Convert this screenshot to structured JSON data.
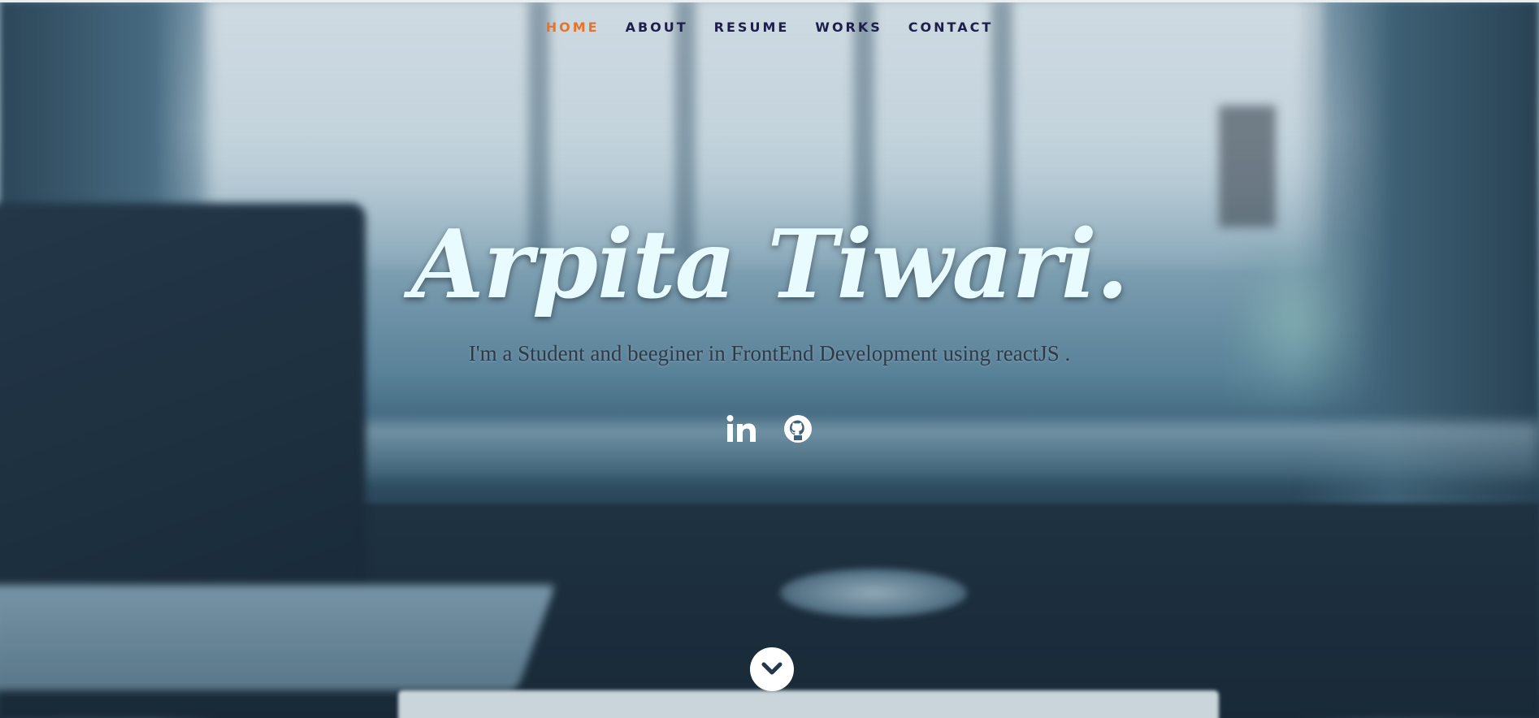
{
  "nav": {
    "items": [
      {
        "label": "HOME",
        "active": true
      },
      {
        "label": "ABOUT"
      },
      {
        "label": "RESUME"
      },
      {
        "label": "WORKS"
      },
      {
        "label": "CONTACT"
      }
    ],
    "active_color": "#e8742a",
    "color": "#1d1f4a"
  },
  "hero": {
    "title": "Arpita Tiwari.",
    "subtitle": "I'm a Student and beeginer in FrontEnd Development using reactJS ."
  },
  "social": {
    "icons": [
      "linkedin-icon",
      "github-icon"
    ]
  },
  "scroll": {
    "icon": "chevron-down-icon"
  }
}
